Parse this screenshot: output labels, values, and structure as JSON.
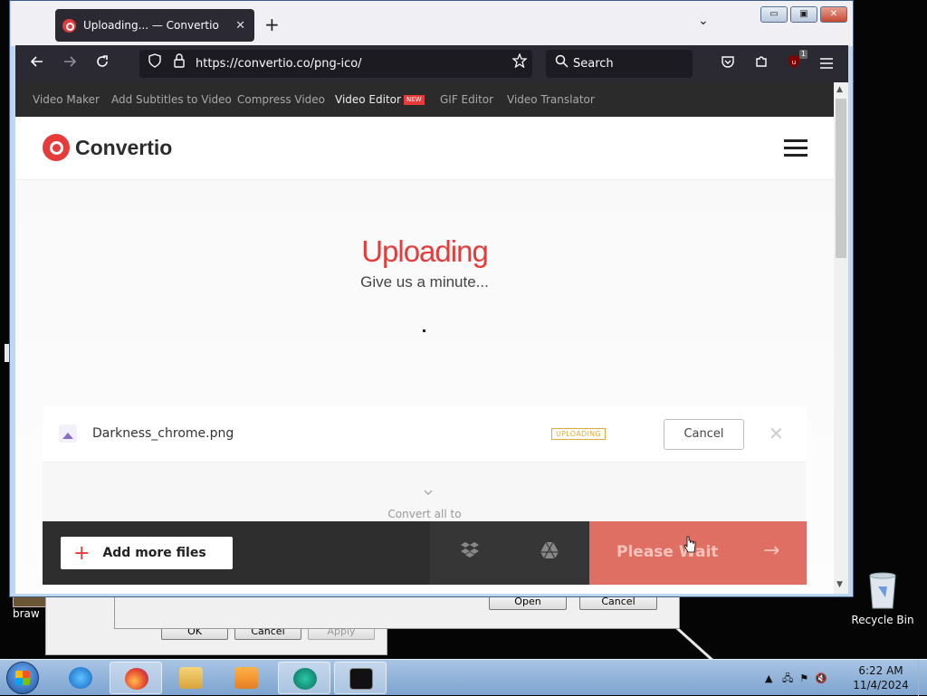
{
  "browser": {
    "tab_title": "Uploading... — Convertio",
    "tab_close": "✕",
    "new_tab": "+",
    "tab_list": "⌄",
    "url": "https://convertio.co/png-ico/",
    "search_placeholder": "Search",
    "extension_badge": "1",
    "window_minimize": "▭",
    "window_maximize": "▣",
    "window_close": "✕"
  },
  "site": {
    "nav_items": [
      "Video Maker",
      "Add Subtitles to Video",
      "Compress Video",
      "Video Editor",
      "GIF Editor",
      "Video Translator"
    ],
    "new_tag": "NEW",
    "logo_text": "Convertio",
    "heading": "Uploading",
    "subheading": "Give us a minute...",
    "file": {
      "name": "Darkness_chrome.png",
      "status": "UPLOADING",
      "cancel_label": "Cancel",
      "remove_icon": "✕"
    },
    "convert_all_label": "Convert all to",
    "add_files_label": "Add more files",
    "wait_label": "Please Wait",
    "wait_arrow": "→",
    "colors": {
      "brand": "#e63b3b",
      "wait_button": "#e06f63",
      "status": "#e0a93a"
    }
  },
  "desktop": {
    "recycle_bin_label": "Recycle Bin",
    "partial_icon_label": "braw",
    "bg_dialog_buttons": [
      "Open",
      "Cancel"
    ],
    "bg_dialog2_buttons": [
      "OK",
      "Cancel",
      "Apply"
    ]
  },
  "taskbar": {
    "apps": [
      "internet-explorer",
      "firefox",
      "file-explorer",
      "media-player",
      "app",
      "command-prompt"
    ],
    "time": "6:22 AM",
    "date": "11/4/2024"
  }
}
